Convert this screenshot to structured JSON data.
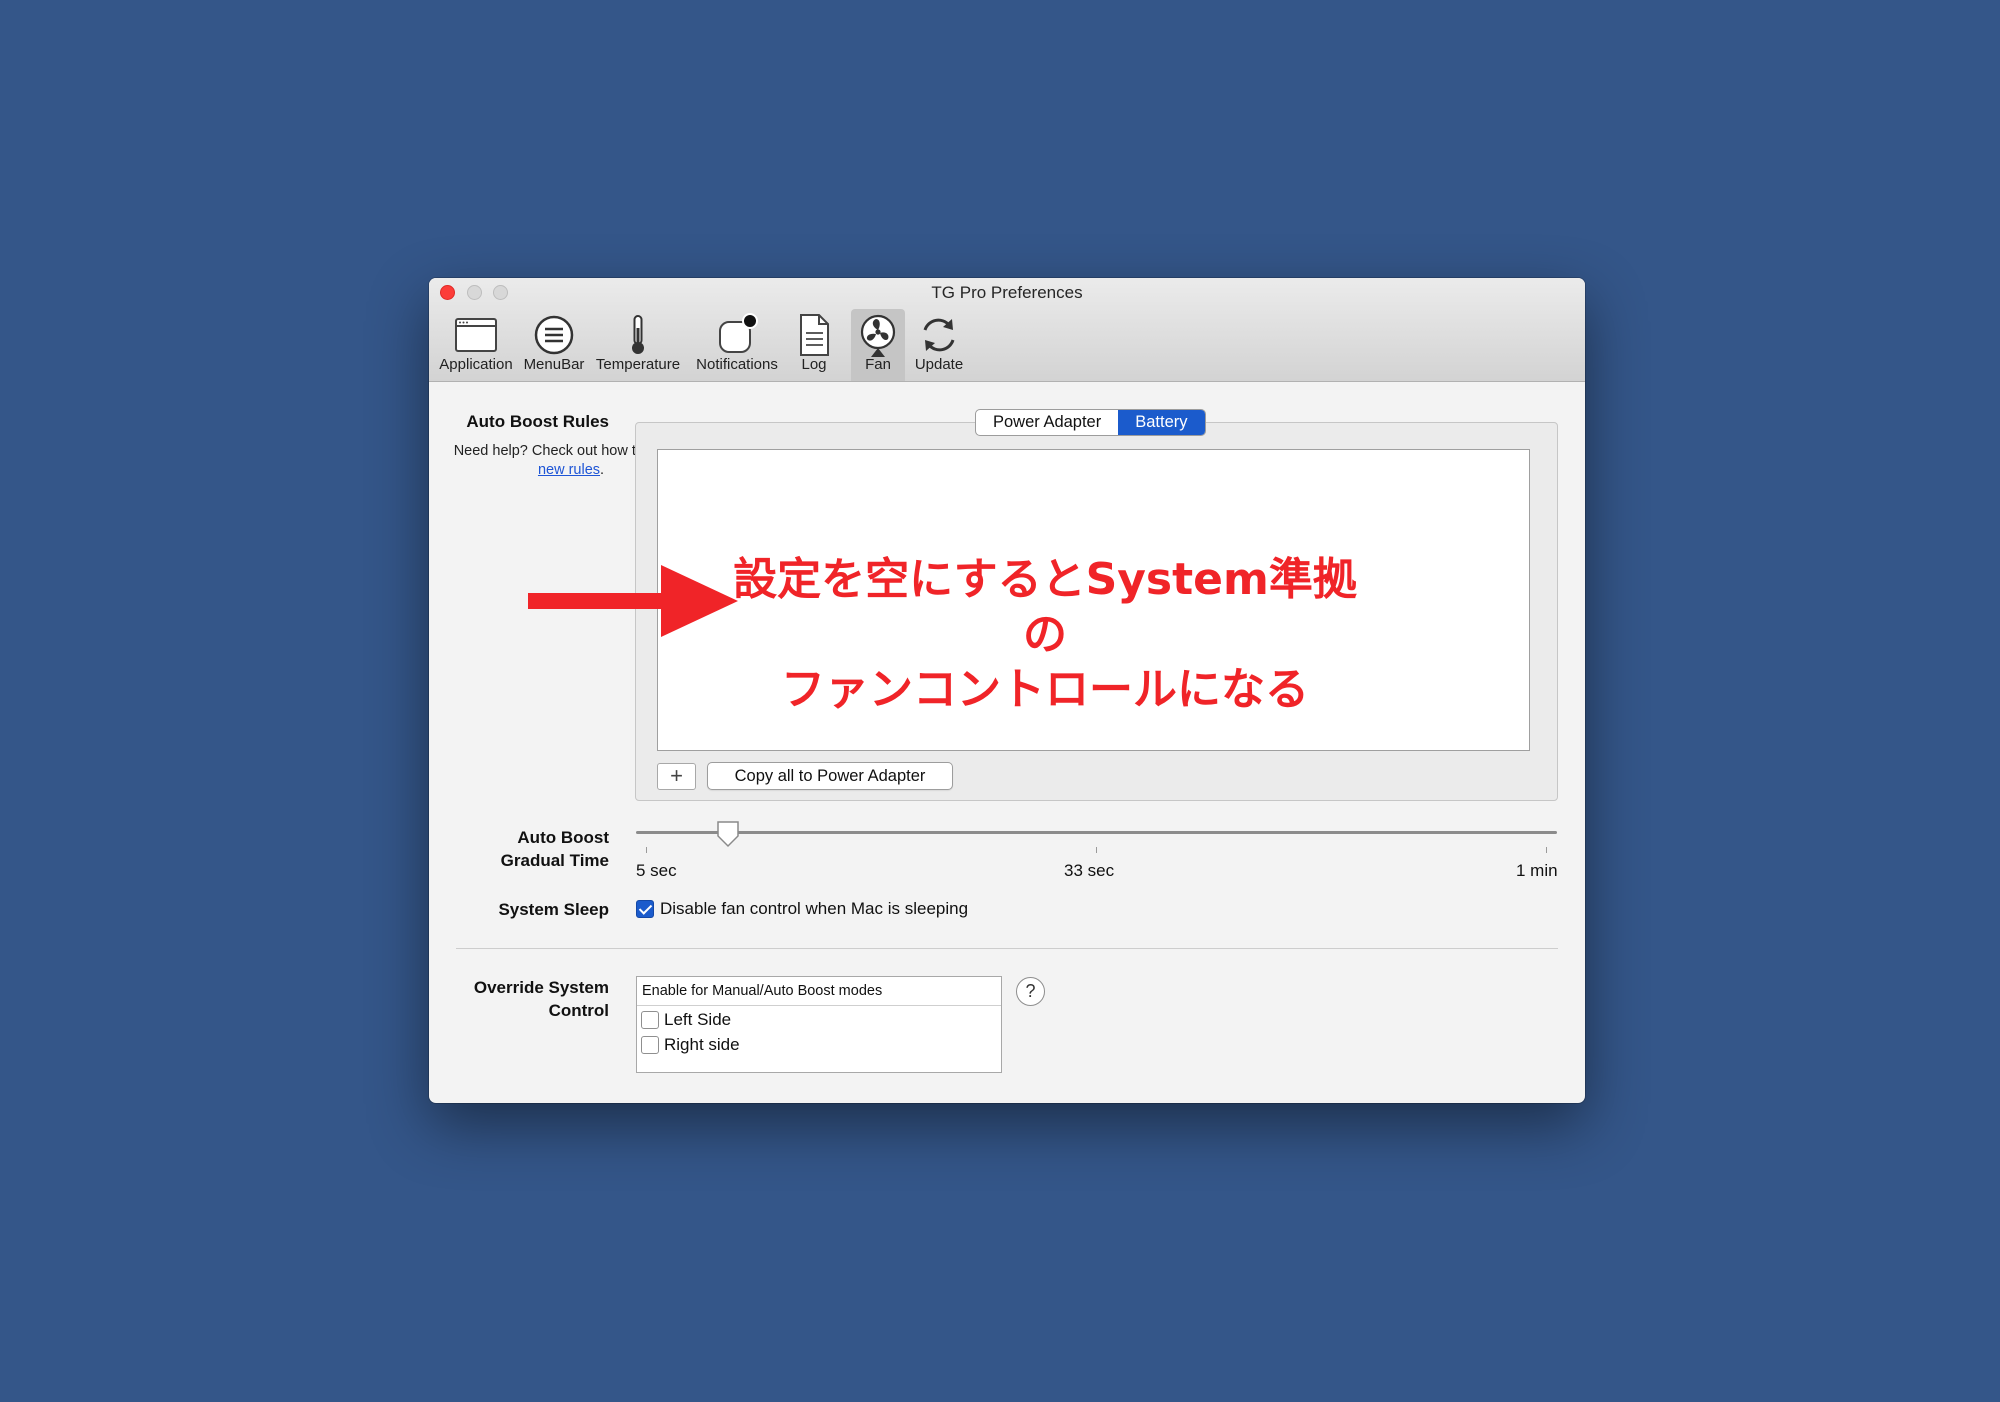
{
  "window": {
    "title": "TG Pro Preferences"
  },
  "toolbar": {
    "items": [
      {
        "label": "Application",
        "icon": "application-window-icon"
      },
      {
        "label": "MenuBar",
        "icon": "menubar-icon"
      },
      {
        "label": "Temperature",
        "icon": "thermometer-icon"
      },
      {
        "label": "Notifications",
        "icon": "notification-badge-icon"
      },
      {
        "label": "Log",
        "icon": "document-icon"
      },
      {
        "label": "Fan",
        "icon": "fan-icon",
        "selected": true
      },
      {
        "label": "Update",
        "icon": "refresh-icon"
      }
    ]
  },
  "auto_boost_rules": {
    "label": "Auto Boost  Rules",
    "help_prefix": "Need help? Check out how to ",
    "help_link": "create new rules",
    "help_suffix": ".",
    "tabs": [
      {
        "label": "Power Adapter",
        "active": false
      },
      {
        "label": "Battery",
        "active": true
      }
    ],
    "add_button": "+",
    "copy_button": "Copy all to Power Adapter"
  },
  "gradual_time": {
    "label_line1": "Auto Boost",
    "label_line2": "Gradual Time",
    "tick_labels": [
      "5 sec",
      "33 sec",
      "1 min"
    ],
    "value_fraction": 0.09
  },
  "system_sleep": {
    "label": "System Sleep",
    "checkbox_label": "Disable fan control when Mac is sleeping",
    "checked": true
  },
  "override": {
    "label_line1": "Override System",
    "label_line2": "Control",
    "header": "Enable for Manual/Auto Boost modes",
    "options": [
      {
        "label": "Left Side",
        "checked": false
      },
      {
        "label": "Right side",
        "checked": false
      }
    ],
    "help_button": "?"
  },
  "annotation": {
    "line1": "設定を空にするとSystem準拠の",
    "line2": "ファンコントロールになる",
    "color": "#f02428"
  },
  "colors": {
    "background": "#345689",
    "accent": "#1b5bcc"
  }
}
